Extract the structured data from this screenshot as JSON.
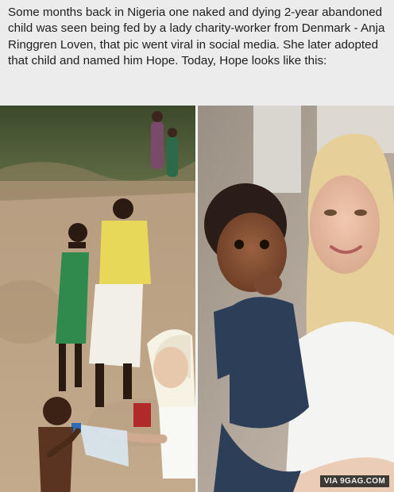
{
  "post": {
    "caption": "Some months back in Nigeria one naked and dying 2-year abandoned child was seen being fed by a lady charity-worker from Denmark - Anja Ringgren Loven, that pic went viral in social media. She later adopted that child and named him Hope. Today, Hope looks like this:"
  },
  "photos": {
    "left": {
      "subject": "charity worker giving water bottle to starving child"
    },
    "right": {
      "subject": "smiling woman holding healthy toddler"
    }
  },
  "watermark": {
    "text": "VIA 9GAG.COM"
  }
}
